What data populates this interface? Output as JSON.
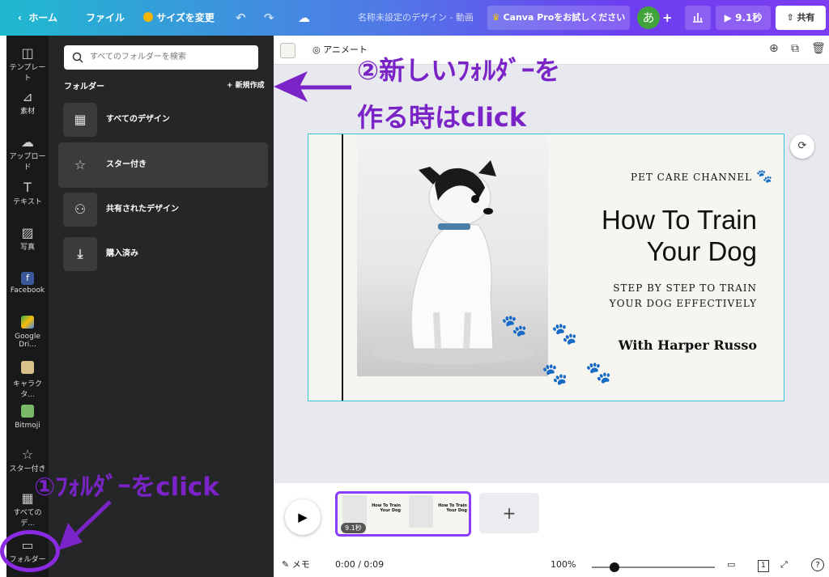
{
  "topbar": {
    "home": "ホーム",
    "file": "ファイル",
    "resize": "サイズを変更",
    "title": "名称未設定のデザイン - 動画",
    "pro": "Canva Proをお試しください",
    "avatar": "あ",
    "plus": "+",
    "duration": "9.1秒",
    "share": "共有"
  },
  "rail": {
    "items": [
      {
        "label": "テンプレート",
        "icon": "template-icon"
      },
      {
        "label": "素材",
        "icon": "elements-icon"
      },
      {
        "label": "アップロード",
        "icon": "upload-icon"
      },
      {
        "label": "テキスト",
        "icon": "text-icon"
      },
      {
        "label": "写真",
        "icon": "photo-icon"
      },
      {
        "label": "Facebook",
        "icon": "facebook-icon"
      },
      {
        "label": "Google Dri...",
        "icon": "google-drive-icon"
      },
      {
        "label": "キャラクタ...",
        "icon": "character-icon"
      },
      {
        "label": "Bitmoji",
        "icon": "bitmoji-icon"
      },
      {
        "label": "スター付き",
        "icon": "star-icon"
      },
      {
        "label": "すべてのデ...",
        "icon": "grid-icon"
      },
      {
        "label": "フォルダー",
        "icon": "folder-icon"
      }
    ]
  },
  "panel": {
    "search_placeholder": "すべてのフォルダーを検索",
    "folder_label": "フォルダー",
    "new": "+ 新規作成",
    "items": [
      {
        "label": "すべてのデザイン",
        "icon": "grid-icon"
      },
      {
        "label": "スター付き",
        "icon": "star-icon"
      },
      {
        "label": "共有されたデザイン",
        "icon": "shared-users-icon"
      },
      {
        "label": "購入済み",
        "icon": "download-icon"
      }
    ]
  },
  "canvas": {
    "animate": "アニメート"
  },
  "design": {
    "channel": "PET CARE CHANNEL",
    "title_line1": "How To Train",
    "title_line2": "Your Dog",
    "sub_line1": "STEP BY STEP TO TRAIN",
    "sub_line2": "YOUR DOG EFFECTIVELY",
    "with": "With Harper Russo"
  },
  "timeline": {
    "duration": "9.1秒",
    "add": "+"
  },
  "bottom": {
    "memo": "メモ",
    "time": "0:00 / 0:09",
    "zoom": "100%",
    "page": "1",
    "help": "?"
  },
  "annotations": {
    "step2_line1": "②新しいﾌｫﾙﾀﾞｰを",
    "step2_line2": "作る時はclick",
    "step1": "①ﾌｫﾙﾀﾞｰをclick"
  },
  "colors": {
    "accent": "#8b3dff",
    "annotation": "#7a24c7",
    "panel_bg": "#252627"
  }
}
